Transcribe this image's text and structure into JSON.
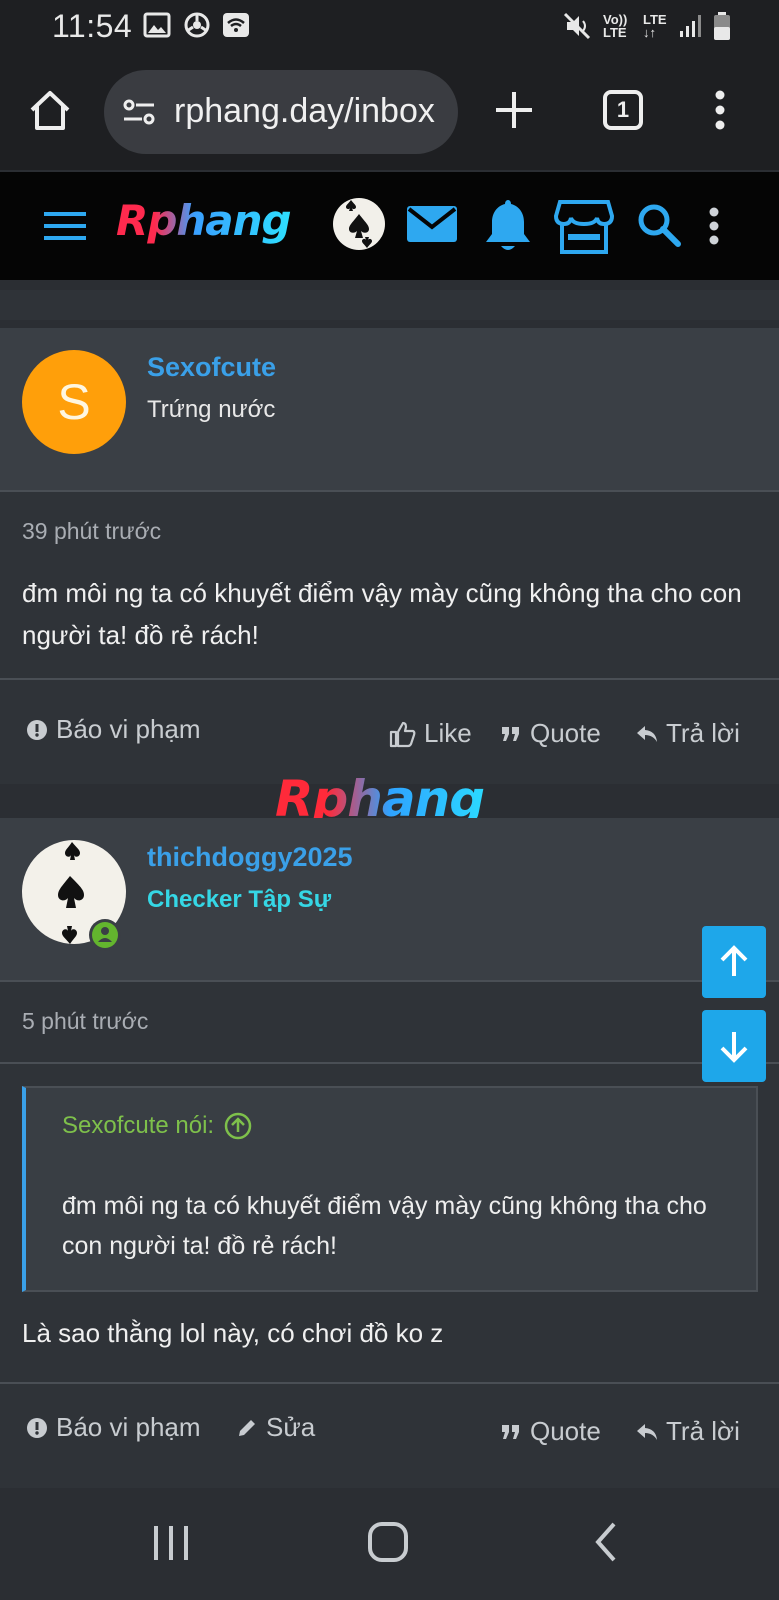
{
  "status_bar": {
    "time": "11:54",
    "volte": "Vo)) LTE",
    "lte": "LTE"
  },
  "browser": {
    "url": "rphang.day/inbox",
    "tab_count": "1"
  },
  "site": {
    "logo": "Rphang",
    "watermark": "Rphang"
  },
  "posts": [
    {
      "username": "Sexofcute",
      "avatar_letter": "S",
      "user_title": "Trứng nước",
      "time": "39 phút trước",
      "message": "đm môi ng ta có khuyết điểm vậy mày cũng không tha cho con người ta! đồ rẻ rách!",
      "actions": {
        "report": "Báo vi phạm",
        "like": "Like",
        "quote": "Quote",
        "reply": "Trả lời"
      }
    },
    {
      "username": "thichdoggy2025",
      "user_title": "Checker Tập Sự",
      "time": "5 phút trước",
      "quote": {
        "author": "Sexofcute nói:",
        "text": "đm môi ng ta có khuyết điểm vậy mày cũng không tha cho con người ta! đồ rẻ rách!"
      },
      "message": "Là sao thằng lol này, có chơi đồ ko z",
      "actions": {
        "report": "Báo vi phạm",
        "edit": "Sửa",
        "quote": "Quote",
        "reply": "Trả lời"
      }
    }
  ],
  "colors": {
    "accent": "#3aa0e8",
    "scroll_button": "#1ea7ea",
    "avatar_orange": "#ff9f0a",
    "quote_author": "#7ec04b",
    "checker_title": "#35d7e5"
  }
}
